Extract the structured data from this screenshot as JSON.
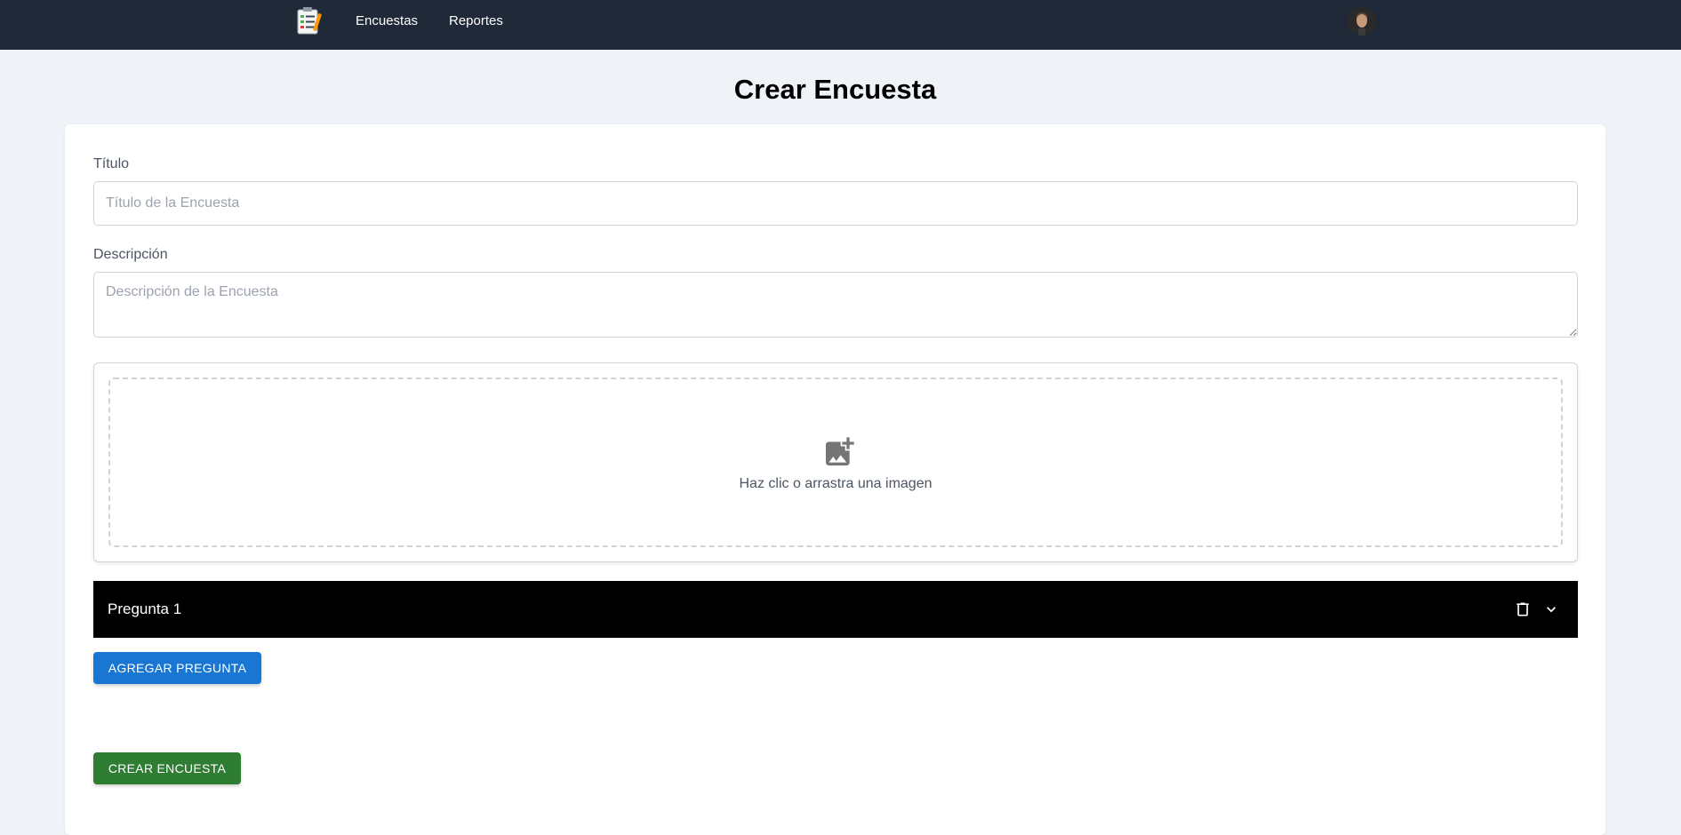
{
  "nav": {
    "logo_icon": "survey-checklist-icon",
    "links": [
      {
        "label": "Encuestas"
      },
      {
        "label": "Reportes"
      }
    ],
    "avatar_icon": "user-avatar"
  },
  "page": {
    "title": "Crear Encuesta"
  },
  "form": {
    "title_label": "Título",
    "title_placeholder": "Título de la Encuesta",
    "title_value": "",
    "description_label": "Descripción",
    "description_placeholder": "Descripción de la Encuesta",
    "description_value": ""
  },
  "image_upload": {
    "icon": "add-photo-icon",
    "prompt": "Haz clic o arrastra una imagen"
  },
  "questions": [
    {
      "label": "Pregunta 1",
      "delete_icon": "trash-icon",
      "expand_icon": "chevron-down-icon"
    }
  ],
  "buttons": {
    "add_question": "AGREGAR PREGUNTA",
    "create_survey": "CREAR ENCUESTA"
  },
  "colors": {
    "navbar": "#1f2937",
    "page_background": "#eff3f8",
    "question_bar": "#000000",
    "add_button": "#1976d2",
    "create_button": "#2e7d32"
  }
}
